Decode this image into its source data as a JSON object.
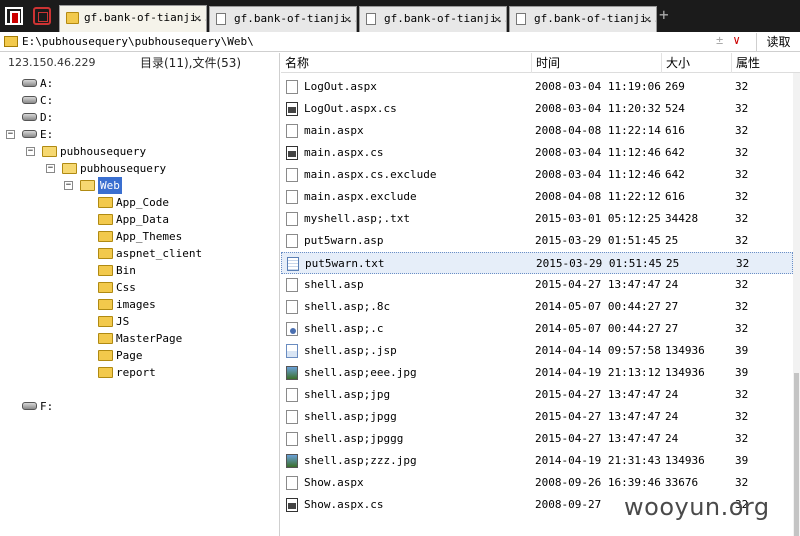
{
  "tabs": [
    {
      "label": "gf.bank-of-tianji...",
      "icon": "folder-icon",
      "active": true
    },
    {
      "label": "gf.bank-of-tianji...",
      "icon": "page-icon",
      "active": false
    },
    {
      "label": "gf.bank-of-tianji...",
      "icon": "page-icon",
      "active": false
    },
    {
      "label": "gf.bank-of-tianji...",
      "icon": "page-icon",
      "active": false
    }
  ],
  "tab_close": "✕",
  "tab_add": "+",
  "address": {
    "path": "E:\\pubhousequery\\pubhousequery\\Web\\",
    "plus": "±",
    "dropdown": "∨",
    "read_button": "读取"
  },
  "left": {
    "ip": "123.150.46.229",
    "counts": "目录(11),文件(53)",
    "tree": [
      {
        "label": "A:",
        "type": "drive",
        "level": 0
      },
      {
        "label": "C:",
        "type": "drive",
        "level": 0
      },
      {
        "label": "D:",
        "type": "drive",
        "level": 0
      },
      {
        "label": "E:",
        "type": "drive",
        "level": 0,
        "expanded": true
      },
      {
        "label": "pubhousequery",
        "type": "folder",
        "level": 1,
        "expanded": true
      },
      {
        "label": "pubhousequery",
        "type": "folder",
        "level": 2,
        "expanded": true
      },
      {
        "label": "Web",
        "type": "folder",
        "level": 3,
        "expanded": true,
        "selected": true
      },
      {
        "label": "App_Code",
        "type": "folder",
        "level": 4
      },
      {
        "label": "App_Data",
        "type": "folder",
        "level": 4
      },
      {
        "label": "App_Themes",
        "type": "folder",
        "level": 4
      },
      {
        "label": "aspnet_client",
        "type": "folder",
        "level": 4
      },
      {
        "label": "Bin",
        "type": "folder",
        "level": 4
      },
      {
        "label": "Css",
        "type": "folder",
        "level": 4
      },
      {
        "label": "images",
        "type": "folder",
        "level": 4
      },
      {
        "label": "JS",
        "type": "folder",
        "level": 4
      },
      {
        "label": "MasterPage",
        "type": "folder",
        "level": 4
      },
      {
        "label": "Page",
        "type": "folder",
        "level": 4
      },
      {
        "label": "report",
        "type": "folder",
        "level": 4
      },
      {
        "label": "F:",
        "type": "drive",
        "level": 0
      }
    ],
    "expand_glyph": "−"
  },
  "columns": {
    "name": "名称",
    "time": "时间",
    "size": "大小",
    "attr": "属性"
  },
  "files": [
    {
      "name": "LogOut.aspx",
      "time": "2008-03-04 11:19:06",
      "size": "269",
      "attr": "32",
      "icon": "page"
    },
    {
      "name": "LogOut.aspx.cs",
      "time": "2008-03-04 11:20:32",
      "size": "524",
      "attr": "32",
      "icon": "cs"
    },
    {
      "name": "main.aspx",
      "time": "2008-04-08 11:22:14",
      "size": "616",
      "attr": "32",
      "icon": "page"
    },
    {
      "name": "main.aspx.cs",
      "time": "2008-03-04 11:12:46",
      "size": "642",
      "attr": "32",
      "icon": "cs"
    },
    {
      "name": "main.aspx.cs.exclude",
      "time": "2008-03-04 11:12:46",
      "size": "642",
      "attr": "32",
      "icon": "page"
    },
    {
      "name": "main.aspx.exclude",
      "time": "2008-04-08 11:22:12",
      "size": "616",
      "attr": "32",
      "icon": "page"
    },
    {
      "name": "myshell.asp;.txt",
      "time": "2015-03-01 05:12:25",
      "size": "34428",
      "attr": "32",
      "icon": "page"
    },
    {
      "name": "put5warn.asp",
      "time": "2015-03-29 01:51:45",
      "size": "25",
      "attr": "32",
      "icon": "page"
    },
    {
      "name": "put5warn.txt",
      "time": "2015-03-29 01:51:45",
      "size": "25",
      "attr": "32",
      "icon": "txt",
      "selected": true
    },
    {
      "name": "shell.asp",
      "time": "2015-04-27 13:47:47",
      "size": "24",
      "attr": "32",
      "icon": "page"
    },
    {
      "name": "shell.asp;.8c",
      "time": "2014-05-07 00:44:27",
      "size": "27",
      "attr": "32",
      "icon": "page"
    },
    {
      "name": "shell.asp;.c",
      "time": "2014-05-07 00:44:27",
      "size": "27",
      "attr": "32",
      "icon": "user"
    },
    {
      "name": "shell.asp;.jsp",
      "time": "2014-04-14 09:57:58",
      "size": "134936",
      "attr": "39",
      "icon": "jsp"
    },
    {
      "name": "shell.asp;eee.jpg",
      "time": "2014-04-19 21:13:12",
      "size": "134936",
      "attr": "39",
      "icon": "jpg"
    },
    {
      "name": "shell.asp;jpg",
      "time": "2015-04-27 13:47:47",
      "size": "24",
      "attr": "32",
      "icon": "page"
    },
    {
      "name": "shell.asp;jpgg",
      "time": "2015-04-27 13:47:47",
      "size": "24",
      "attr": "32",
      "icon": "page"
    },
    {
      "name": "shell.asp;jpggg",
      "time": "2015-04-27 13:47:47",
      "size": "24",
      "attr": "32",
      "icon": "page"
    },
    {
      "name": "shell.asp;zzz.jpg",
      "time": "2014-04-19 21:31:43",
      "size": "134936",
      "attr": "39",
      "icon": "jpg"
    },
    {
      "name": "Show.aspx",
      "time": "2008-09-26 16:39:46",
      "size": "33676",
      "attr": "32",
      "icon": "page"
    },
    {
      "name": "Show.aspx.cs",
      "time": "2008-09-27 ",
      "size": "",
      "attr": "32",
      "icon": "cs"
    }
  ],
  "watermark": "wooyun.org"
}
